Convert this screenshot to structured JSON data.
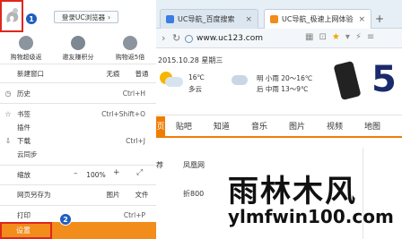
{
  "tabs": [
    {
      "label": "UC导航_百度搜索",
      "color": "#3b7de0"
    },
    {
      "label": "UC导航_极速上网体验",
      "color": "#f28c1a"
    }
  ],
  "address": {
    "url": "www.uc123.com"
  },
  "page": {
    "date": "2015.10.28 星期三",
    "w1_temp": "16℃",
    "w1_cond": "多云",
    "w2_line1": "明 小雨 20～16℃",
    "w2_line2": "后 中雨 13～9℃",
    "banner_number": "5",
    "nav": [
      "贴吧",
      "知道",
      "音乐",
      "图片",
      "视频",
      "地图"
    ],
    "cells": [
      "荐",
      "凤凰网",
      "折800"
    ]
  },
  "watermark": {
    "cn": "雨林木风",
    "en": "ylmfwin100.com"
  },
  "menu": {
    "login": "登录UC浏览器",
    "quick": [
      "购物超级返",
      "邀友赚积分",
      "购物返5倍"
    ],
    "new_window": "新建窗口",
    "traceless": "无痕",
    "normal": "普通",
    "history": "历史",
    "history_short": "Ctrl+H",
    "bookmarks": "书签",
    "bookmarks_short": "Ctrl+Shift+O",
    "plugins": "插件",
    "downloads": "下载",
    "downloads_short": "Ctrl+J",
    "cloud_sync": "云同步",
    "zoom": "缩放",
    "zoom_value": "100%",
    "save_as": "网页另存为",
    "image": "图片",
    "file": "文件",
    "print": "打印",
    "print_short": "Ctrl+P",
    "settings": "设置"
  },
  "badges": {
    "b1": "1",
    "b2": "2"
  },
  "colors": {
    "accent": "#f28c1a",
    "highlight": "#e0261c",
    "badge": "#1f5fbf"
  }
}
